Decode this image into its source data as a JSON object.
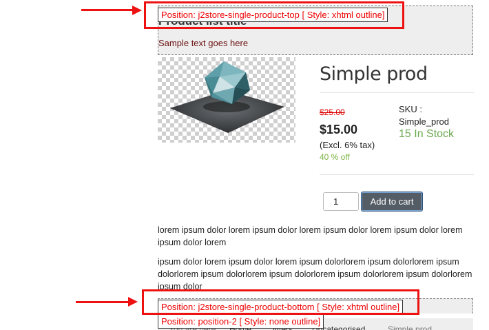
{
  "positions": {
    "top_label": "Position: j2store-single-product-top [ Style: xhtml outline]",
    "bottom_label": "Position: j2store-single-product-bottom [ Style: xhtml outline]",
    "position2_label": "Position: position-2 [ Style: none outline]"
  },
  "module": {
    "title": "Product list title",
    "text": "Sample text goes here"
  },
  "product": {
    "title": "Simple prod",
    "old_price": "$25.00",
    "price": "$15.00",
    "tax_note": "(Excl. 6% tax)",
    "discount": "40 % off",
    "sku_label": "SKU :",
    "sku_value": "Simple_prod",
    "stock": "15 In Stock",
    "quantity": "1",
    "add_to_cart": "Add to cart"
  },
  "description": {
    "p1": "lorem ipsum dolor lorem ipsum dolor lorem ipsum dolor lorem ipsum dolor lorem ipsum dolor lorem",
    "p2": "ipsum dolor lorem ipsum dolor lorem ipsum dolorlorem ipsum dolorlorem ipsum dolorlorem ipsum dolorlorem ipsum dolorlorem ipsum dolorlorem ipsum dolorlorem ipsum dolor"
  },
  "breadcrumb": {
    "prefix": "You are here:",
    "items": [
      "Home",
      "Jitters",
      "Uncategorised",
      "Simple prod"
    ]
  },
  "colors": {
    "annotation": "#e11111",
    "stock": "#6aa84f",
    "discount": "#7cb342",
    "old_price": "#dd0000"
  }
}
